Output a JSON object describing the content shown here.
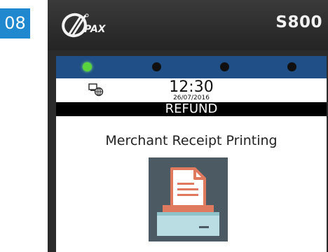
{
  "step": {
    "number": "08",
    "color": "#1f88cf"
  },
  "device": {
    "brand_logo": "pax-logo",
    "model": "S800",
    "leds": [
      {
        "state": "on",
        "color": "#5ad43c"
      },
      {
        "state": "off",
        "color": "#101010"
      },
      {
        "state": "off",
        "color": "#101010"
      },
      {
        "state": "off",
        "color": "#101010"
      }
    ]
  },
  "screen": {
    "status": {
      "icon": "network-icon",
      "time": "12:30",
      "date": "26/07/2016"
    },
    "title": "REFUND",
    "message": "Merchant Receipt Printing",
    "illustration": "printer-icon"
  }
}
